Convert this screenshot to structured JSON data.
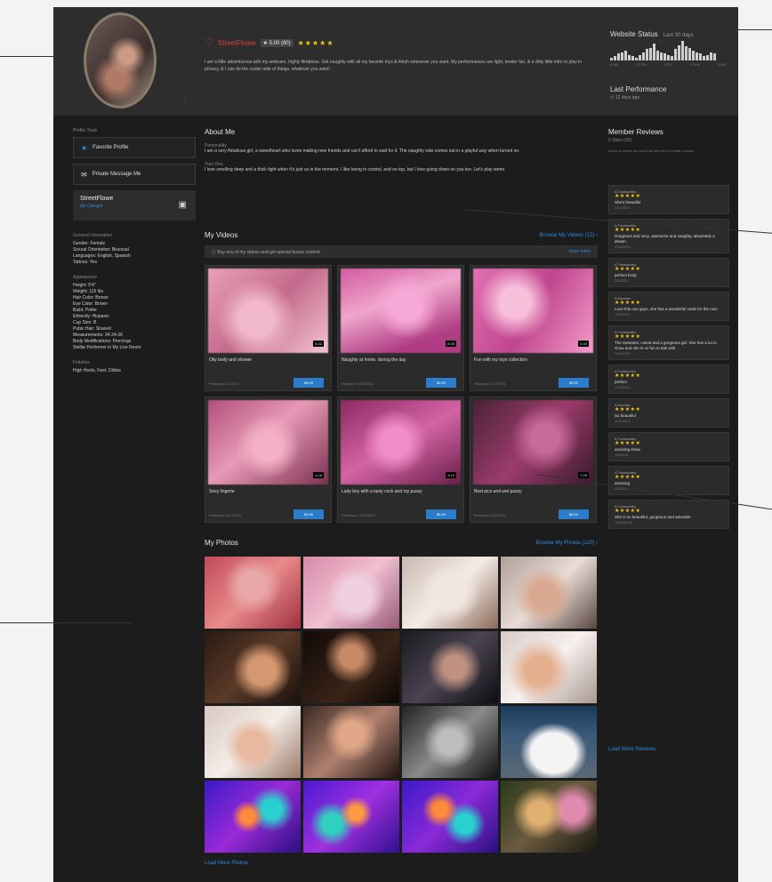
{
  "profile": {
    "name": "StreetFlowe",
    "rating_badge": "★ 5.00 (60)",
    "stars": "★★★★★",
    "bio": "I am a little adventurous with my webcam, highly flirtatious. Get naughty with all my favorite toys & fetish whenever you want. My performances are light, tender fun, & a dirty little intro to play in privacy, & I can do the cooler side of things, whatever you want!"
  },
  "header_stats": {
    "title": "Website Status",
    "sub": "Last 30 days",
    "axis": [
      "6 AM",
      "12 PM",
      "6 PM",
      "12 AM",
      "6 AM"
    ],
    "bars": [
      2,
      3,
      5,
      6,
      7,
      4,
      3,
      2,
      4,
      6,
      8,
      9,
      12,
      7,
      6,
      5,
      4,
      3,
      8,
      11,
      14,
      10,
      9,
      7,
      6,
      5,
      3,
      4,
      6,
      5
    ],
    "last_performance_title": "Last Performance",
    "last_performance_date": "12 days ago"
  },
  "sidebar": {
    "section_label": "Profile Tools",
    "buttons": [
      {
        "label": "Favorite Profile"
      },
      {
        "label": "Private Message Me"
      }
    ],
    "social": {
      "title": "StreetFlowe",
      "sub": "My Camgirl"
    },
    "info1": {
      "hd": "General Information",
      "lines": [
        "Gender: Female",
        "Sexual Orientation: Bisexual",
        "Languages: English, Spanish",
        "Tattoos: Yes"
      ]
    },
    "info2": {
      "hd": "Appearance",
      "lines": [
        "Height: 5'4\"",
        "Weight: 115 lbs",
        "Hair Color: Brown",
        "Eye Color: Brown",
        "Build: Petite",
        "Ethnicity: Hispanic",
        "Cup Size: B",
        "Pubic Hair: Shaved",
        "Measurements: 34-24-36",
        "Body Modifications: Piercings",
        "Stellar Performer in My Live Room"
      ]
    },
    "info3": {
      "hd": "Fetishes",
      "lines": [
        "High Heels, Feet, Dildos"
      ]
    }
  },
  "about": {
    "title": "About Me",
    "h1": "Personality",
    "t1": "I am a very flirtatious girl, a sweetheart who loves making new friends and can't afford to wait for it. The naughty side comes out in a playful way when turned on.",
    "h2": "Turn Ons",
    "t2": "I love smelling deep and a thick tight when it's just us in the moment. I like being in control, and on top, but I love going down on you too. Let's play some."
  },
  "videos": {
    "title": "My Videos",
    "more": "Browse My Videos (12) ›",
    "notice": "Buy any of my videos and get special bonus content",
    "notice_link": "learn more",
    "buy_label": "$9.99",
    "items": [
      {
        "title": "Oily body and shower",
        "date": "Released 2/1/2021",
        "dur": "5:32"
      },
      {
        "title": "Naughty at home, during the day",
        "date": "Released 1/28/2021",
        "dur": "8:05"
      },
      {
        "title": "Fun with my toys collection",
        "date": "Released 1/12/2021",
        "dur": "6:40"
      },
      {
        "title": "Sexy lingerie",
        "date": "Released 12/1/2020",
        "dur": "4:18"
      },
      {
        "title": "Lady boy with a tasty cock and my pussy",
        "date": "Released 11/20/2020",
        "dur": "9:12"
      },
      {
        "title": "Best pics and wet pussy",
        "date": "Released 11/2/2020",
        "dur": "7:25"
      }
    ]
  },
  "photos": {
    "title": "My Photos",
    "more": "Browse My Photos (120) ›",
    "load_more": "Load More Photos"
  },
  "reviews": {
    "title": "Member Reviews",
    "sub": "5 Stars (60)",
    "note": "Leave a review and see this member's private reviews",
    "load_more": "Load More Reviews",
    "items": [
      {
        "user": "A Trustworthy",
        "stars": "★★★★★",
        "comment": "She's beautiful",
        "date": "2/19/2021"
      },
      {
        "user": "A Trustworthy",
        "stars": "★★★★★",
        "comment": "Gorgeous and sexy, awesome and naughty, absolutely a dream.",
        "date": "2/14/2021"
      },
      {
        "user": "A Trustworthy",
        "stars": "★★★★★",
        "comment": "perfect body",
        "date": "2/4/2021"
      },
      {
        "user": "A Member",
        "stars": "★★★★★",
        "comment": "Love this one guys, she has a wonderful smile for the cam",
        "date": "1/29/2021"
      },
      {
        "user": "A Trustworthy",
        "stars": "★★★★★",
        "comment": "The sweetest, cutest and a gorgeous girl. She has a lot to show and she is so fun to talk with.",
        "date": "1/22/2021"
      },
      {
        "user": "A Trustworthy",
        "stars": "★★★★★",
        "comment": "perfect",
        "date": "1/18/2021"
      },
      {
        "user": "A Member",
        "stars": "★★★★★",
        "comment": "So beautiful",
        "date": "1/11/2021"
      },
      {
        "user": "A Trustworthy",
        "stars": "★★★★★",
        "comment": "amazing show",
        "date": "1/6/2021"
      },
      {
        "user": "A Trustworthy",
        "stars": "★★★★★",
        "comment": "amazing",
        "date": "1/2/2021"
      },
      {
        "user": "A Trustworthy",
        "stars": "★★★★★",
        "comment": "She is so beautiful, gorgeous and adorable",
        "date": "12/28/2020"
      }
    ]
  },
  "colors": {
    "accent": "#2b8be0",
    "brand_red": "#e23b3b",
    "star": "#f5c518",
    "page_bg": "#1c1c1c",
    "header_bg": "#2d2d2d"
  }
}
